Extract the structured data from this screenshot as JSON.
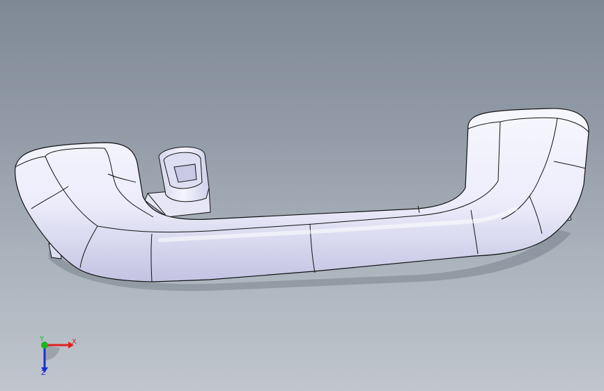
{
  "viewport": {
    "background": [
      "#7f8895",
      "#c1c6cd"
    ],
    "model": {
      "name": "grab handle",
      "fill_light": "#f4f4ff",
      "fill_shade": "#c9c9e8",
      "edge_color": "#111111"
    }
  },
  "triad": {
    "x_label": "X",
    "y_label": "Y",
    "z_label": "Z",
    "x_color": "#e02020",
    "y_color": "#19b619",
    "z_color": "#1a2fd0"
  }
}
